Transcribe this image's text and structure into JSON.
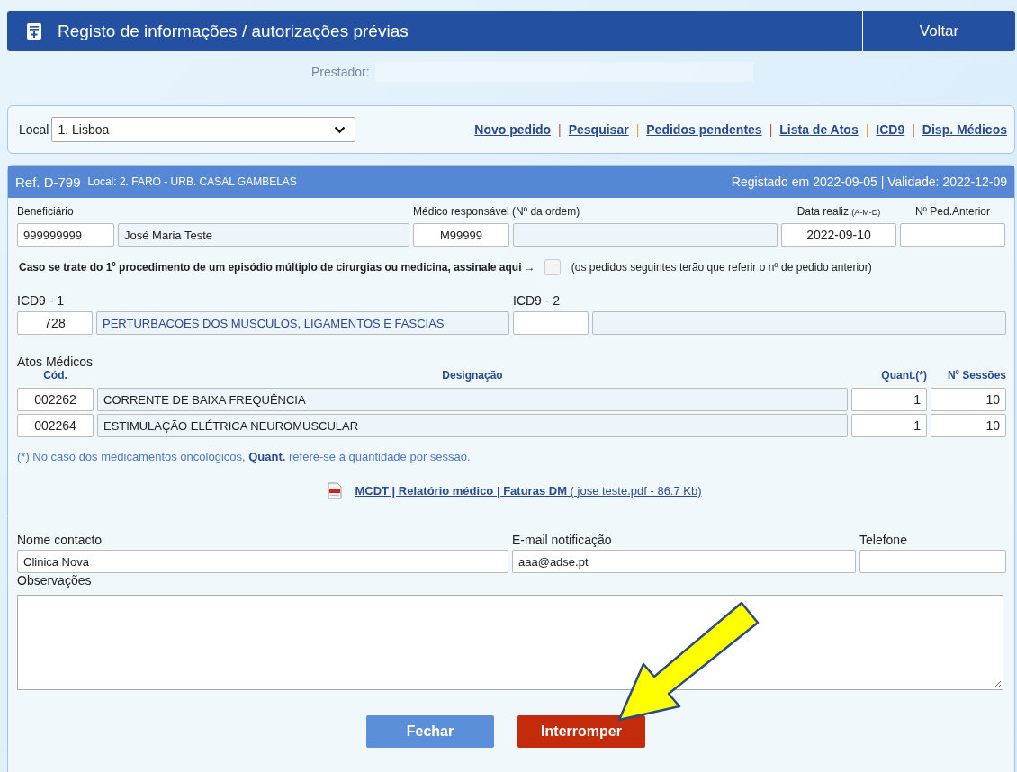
{
  "header": {
    "title": "Registo de informações / autorizações prévias",
    "back_button": "Voltar"
  },
  "provider": {
    "label": "Prestador:"
  },
  "location_bar": {
    "label": "Local",
    "select_value": "1. Lisboa",
    "separator": "|",
    "links": [
      "Novo pedido",
      "Pesquisar",
      "Pedidos pendentes",
      "Lista de Atos",
      "ICD9",
      "Disp. Médicos"
    ]
  },
  "request": {
    "ref": "Ref. D-799",
    "location": "Local: 2. FARO - URB. CASAL GAMBELAS",
    "registered": "Registado em 2022-09-05 | Validade: 2022-12-09",
    "beneficiary": {
      "label": "Beneficiário",
      "number": "999999999",
      "name": "José Maria Teste"
    },
    "doctor": {
      "label": "Médico responsável (Nº da ordem)",
      "number": "M99999"
    },
    "date": {
      "label": "Data realiz.",
      "hint": "(A-M-D)",
      "value": "2022-09-10"
    },
    "previous": {
      "label": "Nº Ped.Anterior"
    },
    "multi": {
      "text": "Caso se trate do 1º procedimento de um episódio múltiplo de cirurgias ou medicina, assinale aqui →",
      "checked": false,
      "note": "(os pedidos seguintes terão que referir o nº de pedido anterior)"
    },
    "icd9_1": {
      "label": "ICD9 - 1",
      "code": "728",
      "description": "PERTURBACOES DOS MUSCULOS, LIGAMENTOS E FASCIAS"
    },
    "icd9_2": {
      "label": "ICD9 - 2"
    },
    "acts": {
      "label": "Atos Médicos",
      "columns": [
        "Cód.",
        "Designação",
        "Quant.(*)",
        "Nº Sessões"
      ],
      "rows": [
        {
          "code": "002262",
          "name": "CORRENTE DE BAIXA FREQUÊNCIA",
          "qty": "1",
          "sessions": "10"
        },
        {
          "code": "002264",
          "name": "ESTIMULAÇÃO ELÉTRICA NEUROMUSCULAR",
          "qty": "1",
          "sessions": "10"
        }
      ]
    },
    "footnote": "(*) No caso dos medicamentos oncológicos, **Quant.** refere-se à quantidade por sessão.",
    "attachment": {
      "link": "MCDT | Relatório médico | Faturas DM",
      "file": "( jose teste.pdf - 86.7 Kb)"
    },
    "contact": {
      "name_label": "Nome contacto",
      "name": "Clinica Nova",
      "email_label": "E-mail notificação",
      "email": "aaa@adse.pt",
      "phone_label": "Telefone"
    },
    "notes": {
      "label": "Observações"
    },
    "buttons": [
      {
        "label": "Fechar",
        "kind": "secondary"
      },
      {
        "label": "Interromper",
        "kind": "danger"
      }
    ]
  }
}
